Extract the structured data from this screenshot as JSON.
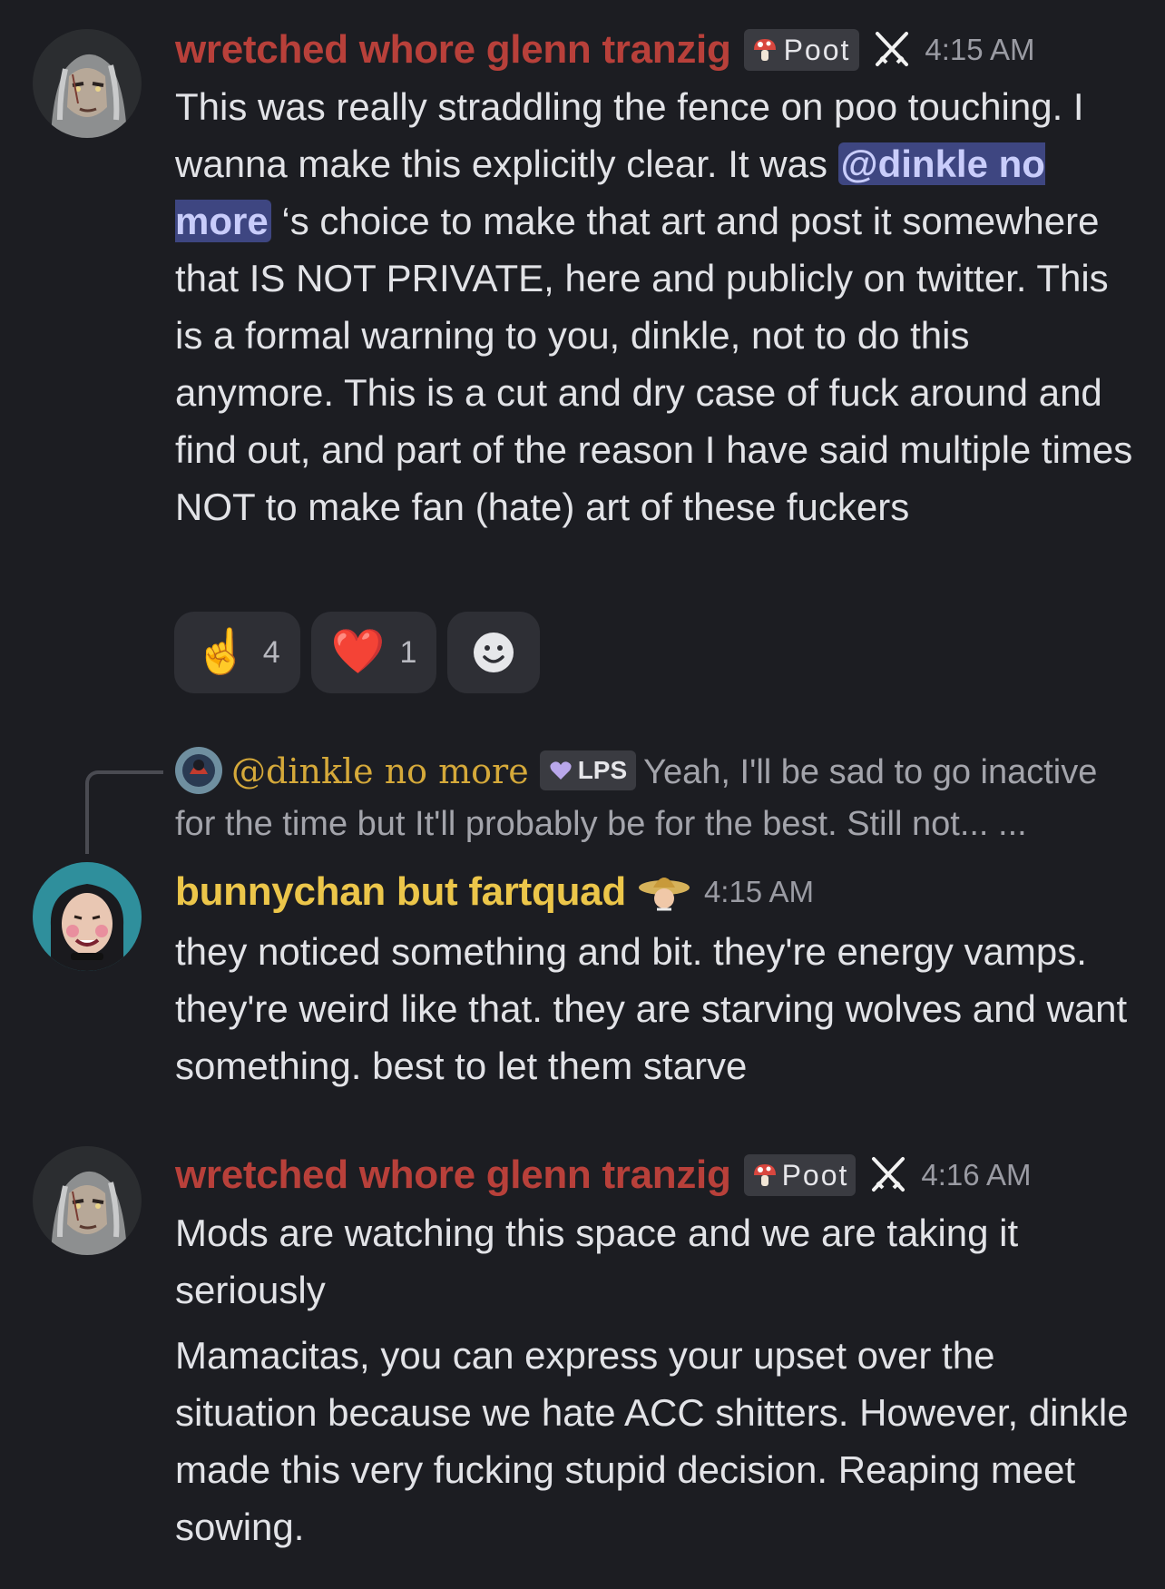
{
  "colors": {
    "background": "#1c1d22",
    "glenn_name": "#b8403a",
    "bunny_name": "#ecc64a",
    "mention_bg": "#3e4681",
    "reply_name": "#d5a93a"
  },
  "messages": [
    {
      "username": "wretched whore glenn tranzig",
      "tag": "Poot",
      "time": "4:15 AM",
      "text_before": "This was really straddling the fence on poo touching. I wanna make this explicitly clear. It was ",
      "mention": "@dinkle no more",
      "text_after": " ‘s choice to make that art and post it somewhere that IS NOT PRIVATE, here and publicly on twitter. This is a formal warning to you, dinkle, not to do this anymore. This is a cut and dry case of fuck around and find out, and part of the reason I have said multiple times NOT to make fan (hate) art of these fuckers",
      "reactions": [
        {
          "icon": "pointing-up-emoji",
          "glyph": "☝️",
          "count": "4"
        },
        {
          "icon": "red-heart-emoji",
          "glyph": "❤️",
          "count": "1"
        }
      ]
    },
    {
      "reply": {
        "username": "@dinkle no more",
        "tag": "LPS",
        "preview": "Yeah, I'll be sad to go inactive for the time but It'll probably be for the best. Still not... ..."
      },
      "username": "bunnychan but fartquad",
      "time": "4:15 AM",
      "text": "they noticed something and bit. they're energy vamps. they're weird like that. they are starving wolves and want something. best to let them starve"
    },
    {
      "username": "wretched whore glenn tranzig",
      "tag": "Poot",
      "time": "4:16 AM",
      "paragraph1": "Mods are watching this space and we are taking it seriously",
      "paragraph2": "Mamacitas, you can express your upset over the situation because we hate ACC shitters. However, dinkle made this very fucking stupid decision. Reaping meet sowing."
    }
  ]
}
